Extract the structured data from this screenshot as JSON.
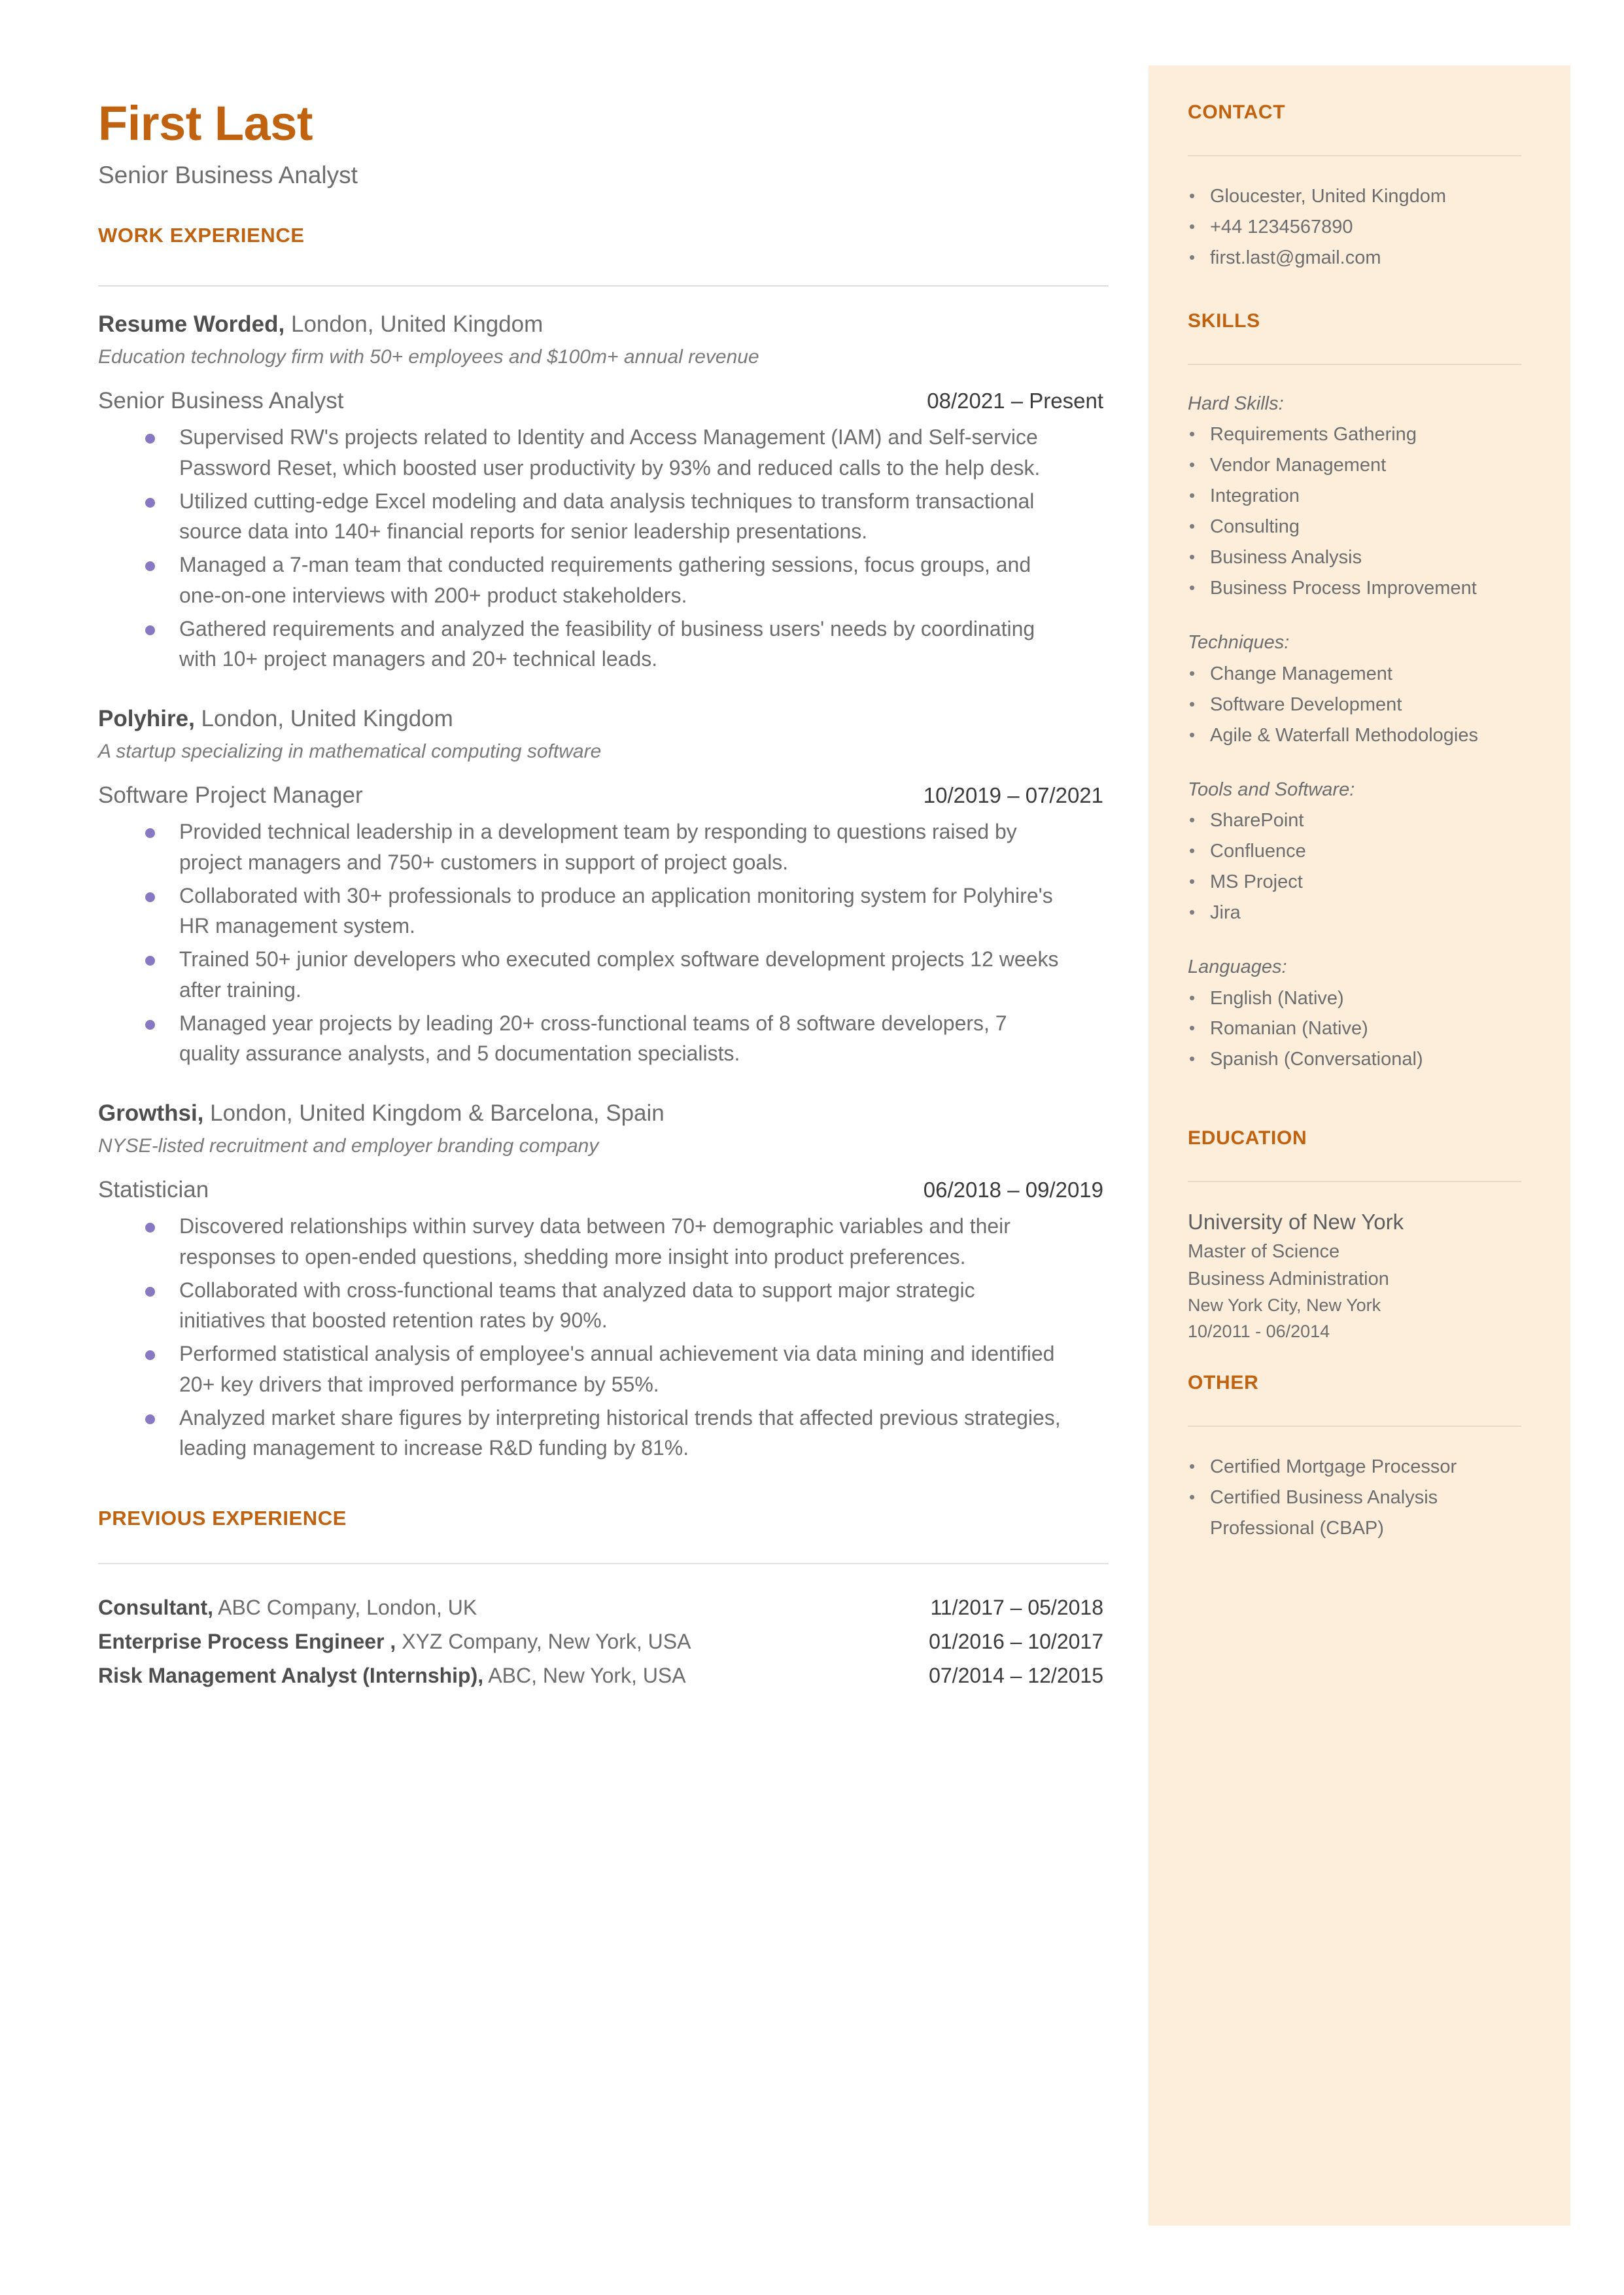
{
  "theme": {
    "accent": "#C0620F",
    "sidebar_bg": "#FDEEDC",
    "bullet_purple": "#8878C3",
    "body_text": "#6d6d6d"
  },
  "header": {
    "name": "First Last",
    "job_title": "Senior Business Analyst"
  },
  "work_experience": {
    "heading": "WORK EXPERIENCE",
    "entries": [
      {
        "company": "Resume Worded,",
        "location": " London, United Kingdom",
        "description": "Education technology firm with 50+ employees and $100m+ annual revenue",
        "role": "Senior Business Analyst",
        "dates": "08/2021 – Present",
        "bullets": [
          "Supervised RW's projects related to Identity and Access Management (IAM) and Self-service Password Reset, which boosted user productivity by 93% and reduced calls to the help desk.",
          "Utilized cutting-edge Excel modeling and data analysis techniques to transform transactional source data into 140+ financial reports for senior leadership presentations.",
          "Managed a 7-man team that conducted requirements gathering sessions, focus groups, and one-on-one interviews with 200+ product stakeholders.",
          "Gathered requirements and analyzed the feasibility of business users' needs by coordinating with 10+ project managers and 20+ technical leads."
        ]
      },
      {
        "company": "Polyhire,",
        "location": " London, United Kingdom",
        "description": "A startup specializing in mathematical computing software",
        "role": "Software Project Manager",
        "dates": "10/2019 – 07/2021",
        "bullets": [
          "Provided technical leadership in a development team by responding to questions raised by project managers and 750+ customers in support of project goals.",
          "Collaborated with 30+ professionals to produce an application monitoring system for Polyhire's HR management system.",
          "Trained 50+ junior developers who executed complex software development projects 12 weeks after training.",
          "Managed year projects by leading 20+ cross-functional teams of 8 software developers, 7 quality assurance analysts, and 5 documentation specialists."
        ]
      },
      {
        "company": "Growthsi,",
        "location": " London, United Kingdom & Barcelona, Spain",
        "description": "NYSE-listed recruitment and employer branding company",
        "role": "Statistician",
        "dates": "06/2018 – 09/2019",
        "bullets": [
          "Discovered relationships within survey data between 70+ demographic variables and their responses to open-ended questions, shedding more insight into product preferences.",
          "Collaborated with cross-functional teams that analyzed data to support major strategic initiatives that boosted retention rates by 90%.",
          "Performed statistical analysis of employee's annual achievement via data mining and identified 20+ key drivers that improved performance by 55%.",
          "Analyzed market share figures by interpreting historical trends that affected previous strategies, leading management to increase R&D funding by 81%."
        ]
      }
    ]
  },
  "previous_experience": {
    "heading": "PREVIOUS EXPERIENCE",
    "rows": [
      {
        "title": "Consultant,",
        "detail": " ABC Company, London, UK",
        "dates": "11/2017 – 05/2018"
      },
      {
        "title": "Enterprise Process Engineer ,",
        "detail": " XYZ Company, New York, USA",
        "dates": "01/2016 – 10/2017"
      },
      {
        "title": "Risk Management Analyst (Internship),",
        "detail": " ABC, New York, USA",
        "dates": "07/2014 – 12/2015"
      }
    ]
  },
  "sidebar": {
    "contact": {
      "heading": "CONTACT",
      "items": [
        "Gloucester, United Kingdom",
        "+44 1234567890",
        "first.last@gmail.com"
      ]
    },
    "skills": {
      "heading": "SKILLS",
      "groups": [
        {
          "label": "Hard Skills:",
          "items": [
            "Requirements Gathering",
            "Vendor Management",
            "Integration",
            "Consulting",
            "Business Analysis",
            "Business Process Improvement"
          ]
        },
        {
          "label": "Techniques:",
          "items": [
            "Change Management",
            "Software Development",
            "Agile & Waterfall Methodologies"
          ]
        },
        {
          "label": "Tools and Software:",
          "items": [
            "SharePoint",
            "Confluence",
            "MS Project",
            "Jira"
          ]
        },
        {
          "label": "Languages:",
          "items": [
            "English (Native)",
            "Romanian (Native)",
            "Spanish (Conversational)"
          ]
        }
      ]
    },
    "education": {
      "heading": "EDUCATION",
      "school": "University of New York",
      "degree": "Master of Science",
      "field": "Business Administration",
      "location": "New York City, New York",
      "dates": "10/2011 - 06/2014"
    },
    "other": {
      "heading": "OTHER",
      "items": [
        "Certified Mortgage Processor",
        "Certified Business Analysis Professional (CBAP)"
      ]
    }
  }
}
